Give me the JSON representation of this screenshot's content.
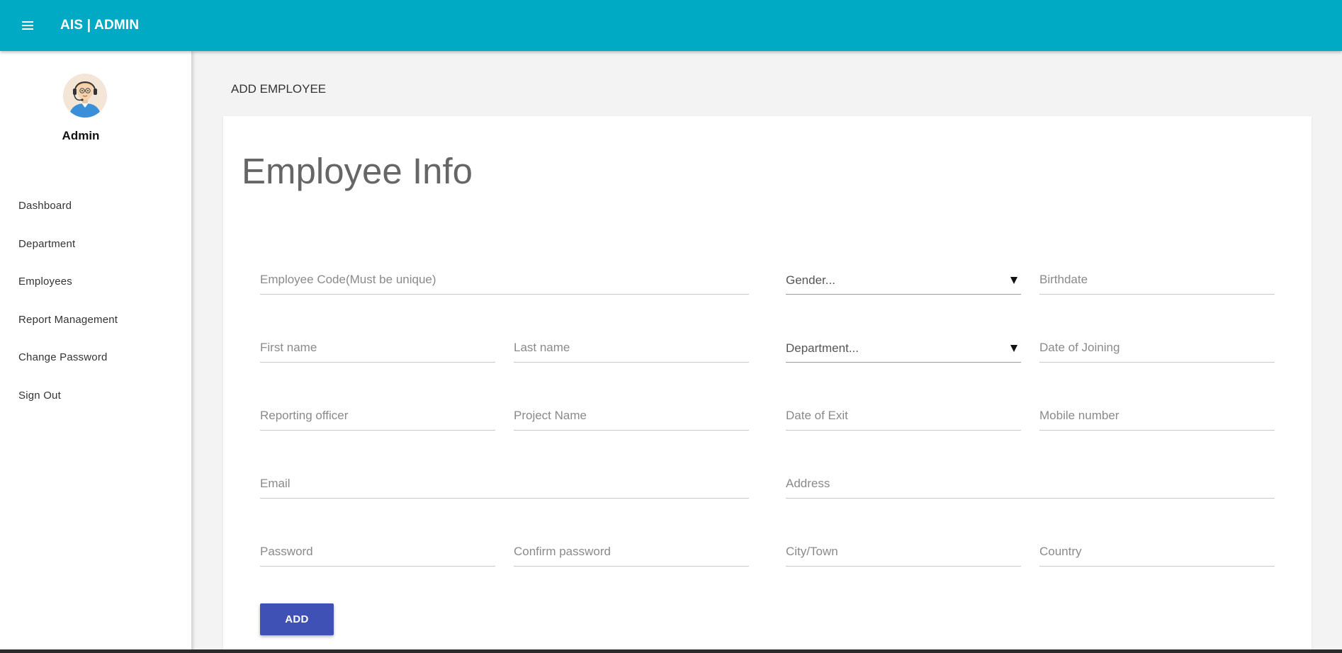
{
  "header": {
    "brand": "AIS | ADMIN",
    "menu_icon": "hamburger-menu-icon"
  },
  "sidebar": {
    "user_name": "Admin",
    "avatar_icon": "support-agent-avatar",
    "items": [
      {
        "label": "Dashboard"
      },
      {
        "label": "Department"
      },
      {
        "label": "Employees"
      },
      {
        "label": "Report Management"
      },
      {
        "label": "Change Password"
      },
      {
        "label": "Sign Out"
      }
    ]
  },
  "page": {
    "title": "ADD EMPLOYEE"
  },
  "form": {
    "title": "Employee Info",
    "fields": {
      "employee_code": "Employee Code(Must be unique)",
      "gender": "Gender...",
      "birthdate": "Birthdate",
      "first_name": "First name",
      "last_name": "Last name",
      "department": "Department...",
      "date_of_joining": "Date of Joining",
      "reporting_officer": "Reporting officer",
      "project_name": "Project Name",
      "date_of_exit": "Date of Exit",
      "mobile_number": "Mobile number",
      "email": "Email",
      "address": "Address",
      "password": "Password",
      "confirm_password": "Confirm password",
      "city_town": "City/Town",
      "country": "Country"
    },
    "submit_label": "ADD"
  },
  "colors": {
    "header": "#00a9c4",
    "button": "#3f51b5",
    "background": "#f3f3f3"
  }
}
